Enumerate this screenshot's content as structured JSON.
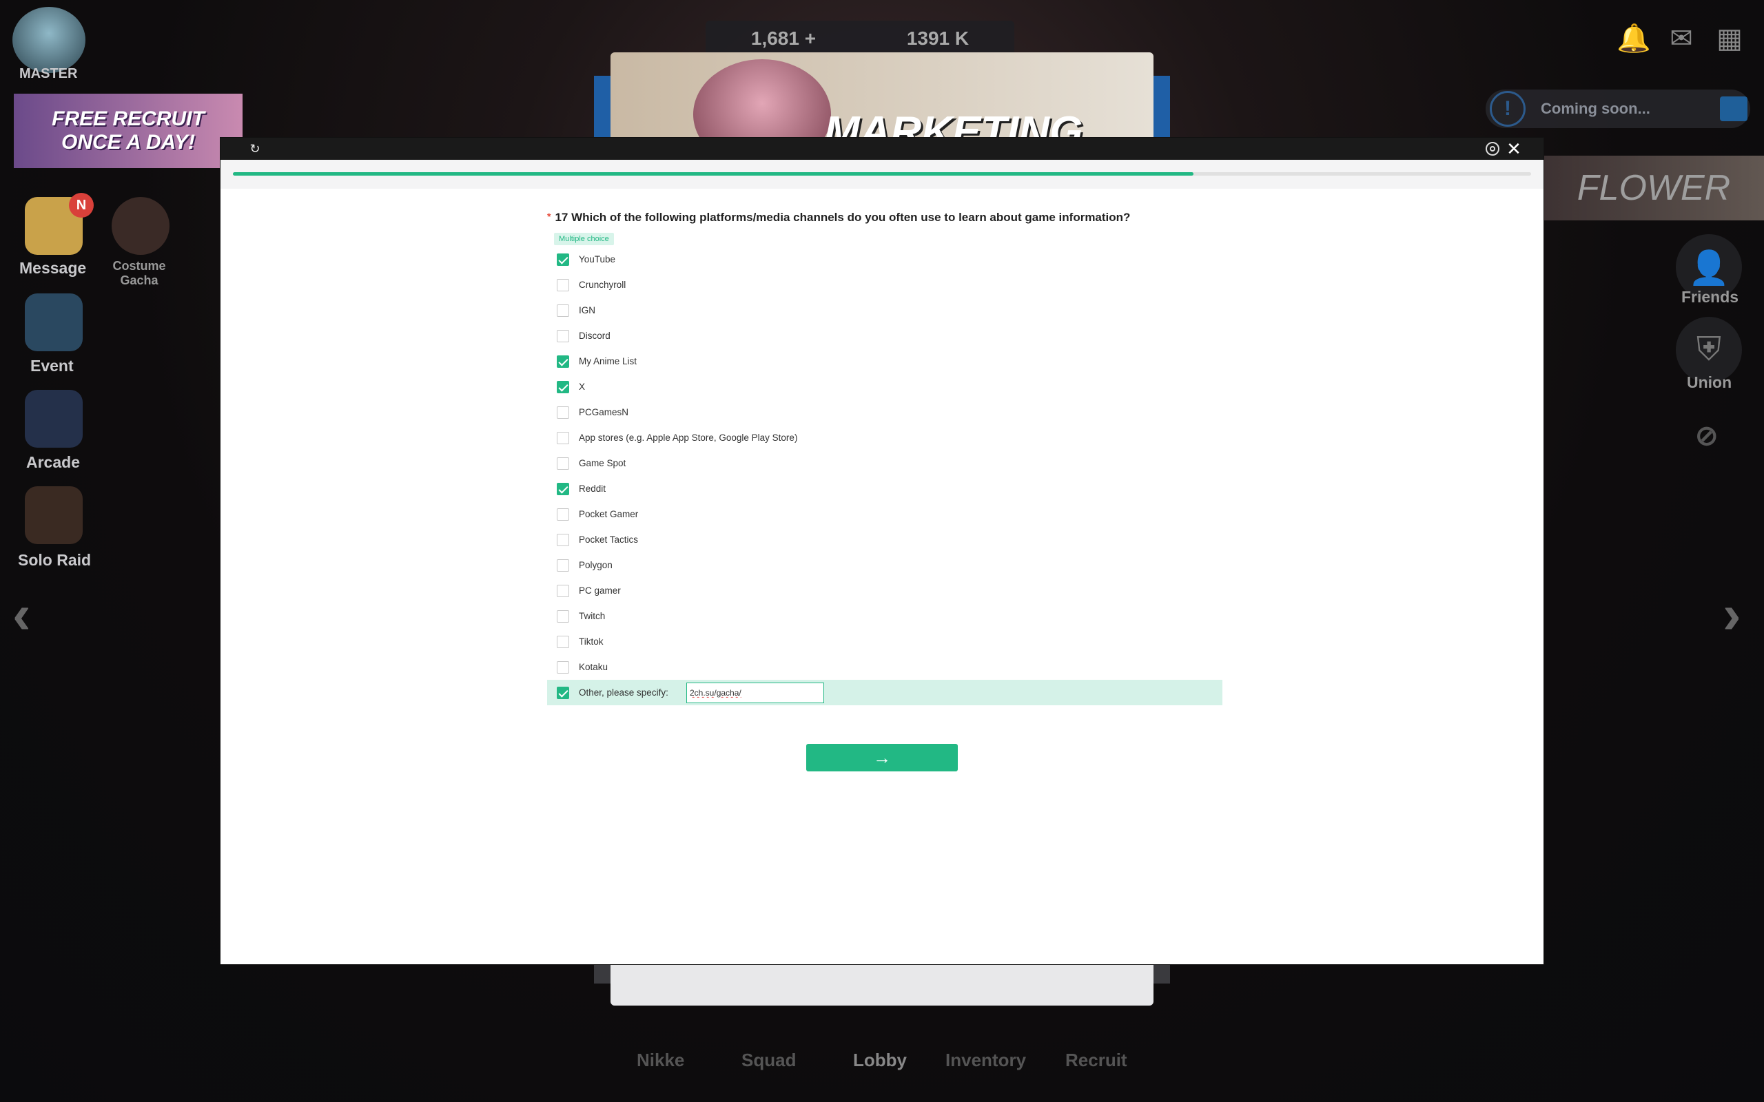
{
  "game": {
    "rank_label": "MASTER",
    "recruit_banner": [
      "FREE RECRUIT",
      "ONCE A DAY!"
    ],
    "currency": [
      "1,681 +",
      "1391 K"
    ],
    "coming_soon": "Coming soon...",
    "pass_banner": "FLOWER",
    "marketing_title": "MARKETING",
    "left_menu": [
      {
        "label": "Message",
        "badge": "N"
      },
      {
        "label": "Costume Gacha"
      },
      {
        "label": "Event"
      },
      {
        "label": "Arcade"
      },
      {
        "label": "Solo Raid"
      }
    ],
    "right_menu": [
      {
        "label": "Friends"
      },
      {
        "label": "Union"
      }
    ],
    "bottom_nav": [
      "Nikke",
      "Squad",
      "Lobby",
      "Inventory",
      "Recruit"
    ],
    "icons": {
      "left_arrow": "‹",
      "right_arrow": "›",
      "bell": "🔔",
      "mail": "✉",
      "grid": "▦"
    }
  },
  "survey": {
    "progress": 0.74,
    "question_number": "17",
    "question_text": "Which of the following platforms/media channels do you often use to learn about game information?",
    "required_mark": "*",
    "type_badge": "Multiple choice",
    "accent_color": "#22b884",
    "options": [
      {
        "label": "YouTube",
        "checked": true
      },
      {
        "label": "Crunchyroll",
        "checked": false
      },
      {
        "label": "IGN",
        "checked": false
      },
      {
        "label": "Discord",
        "checked": false
      },
      {
        "label": "My Anime List",
        "checked": true
      },
      {
        "label": "X",
        "checked": true
      },
      {
        "label": "PCGamesN",
        "checked": false
      },
      {
        "label": "App stores (e.g. Apple App Store, Google Play Store)",
        "checked": false
      },
      {
        "label": "Game Spot",
        "checked": false
      },
      {
        "label": "Reddit",
        "checked": true
      },
      {
        "label": "Pocket Gamer",
        "checked": false
      },
      {
        "label": "Pocket Tactics",
        "checked": false
      },
      {
        "label": "Polygon",
        "checked": false
      },
      {
        "label": "PC gamer",
        "checked": false
      },
      {
        "label": "Twitch",
        "checked": false
      },
      {
        "label": "Tiktok",
        "checked": false
      },
      {
        "label": "Kotaku",
        "checked": false
      }
    ],
    "other": {
      "label": "Other, please specify:",
      "checked": true,
      "value": "2ch.su/gacha/"
    },
    "next_icon": "→"
  }
}
